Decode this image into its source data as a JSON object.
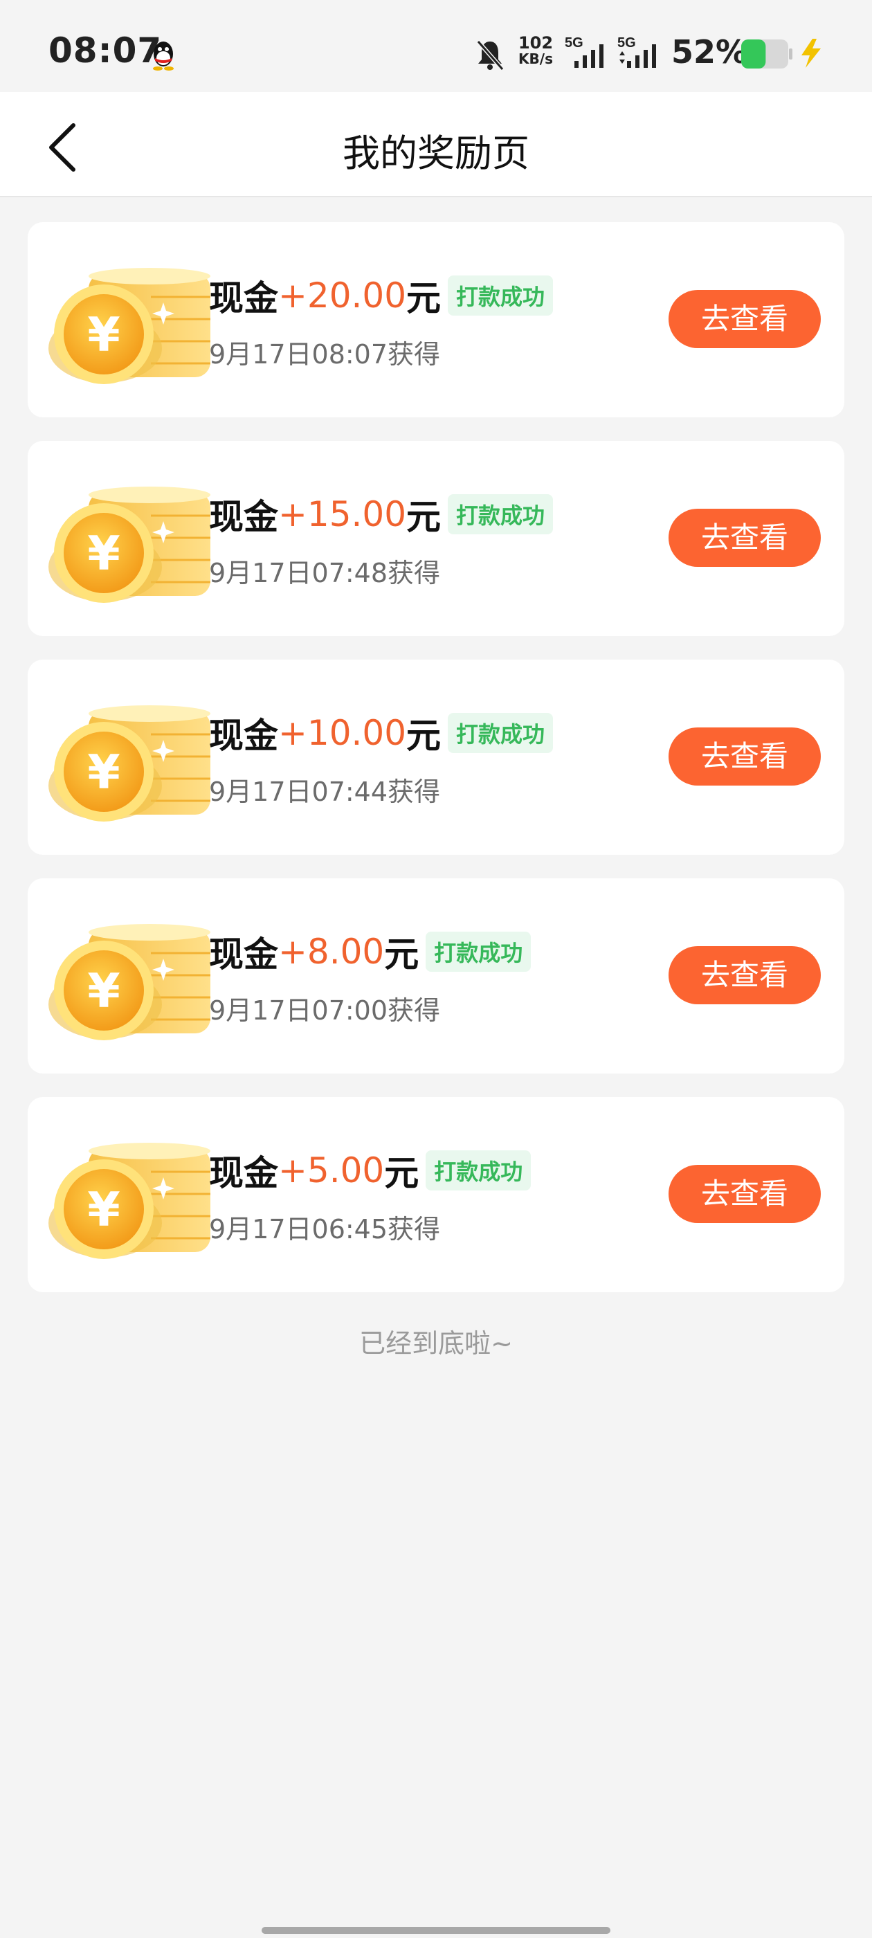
{
  "status_bar": {
    "time": "08:07",
    "net_speed": "102",
    "net_unit": "KB/s",
    "sim1": "5G",
    "sim2": "5G",
    "battery": "52%",
    "battery_level": 0.52,
    "icons": [
      "qq-icon",
      "bell-muted-icon",
      "signal-icon",
      "battery-icon",
      "charging-bolt-icon"
    ]
  },
  "header": {
    "title": "我的奖励页",
    "back_icon": "chevron-left-icon"
  },
  "rewards": [
    {
      "label": "现金",
      "amount": "+20.00",
      "unit": "元",
      "status": "打款成功",
      "time": "9月17日08:07获得",
      "button": "去查看"
    },
    {
      "label": "现金",
      "amount": "+15.00",
      "unit": "元",
      "status": "打款成功",
      "time": "9月17日07:48获得",
      "button": "去查看"
    },
    {
      "label": "现金",
      "amount": "+10.00",
      "unit": "元",
      "status": "打款成功",
      "time": "9月17日07:44获得",
      "button": "去查看"
    },
    {
      "label": "现金",
      "amount": "+8.00",
      "unit": "元",
      "status": "打款成功",
      "time": "9月17日07:00获得",
      "button": "去查看"
    },
    {
      "label": "现金",
      "amount": "+5.00",
      "unit": "元",
      "status": "打款成功",
      "time": "9月17日06:45获得",
      "button": "去查看"
    }
  ],
  "footer": {
    "end_text": "已经到底啦~"
  },
  "colors": {
    "accent": "#fc6431",
    "amount": "#f0622e",
    "success": "#36b85a",
    "background": "#f4f4f4"
  }
}
